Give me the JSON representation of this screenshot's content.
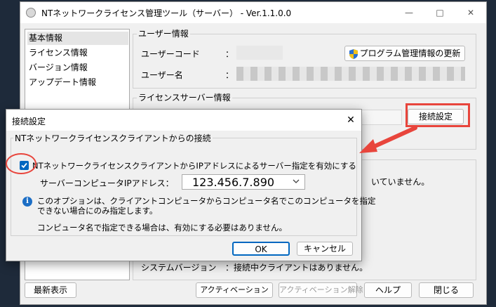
{
  "main": {
    "title": "NTネットワークライセンス管理ツール（サーバー） - Ver.1.1.0.0",
    "sidebar_items": [
      "基本情報",
      "ライセンス情報",
      "バージョン情報",
      "アップデート情報"
    ],
    "user_group_title": "ユーザー情報",
    "user_code_label": "ユーザーコード",
    "user_name_label": "ユーザー名",
    "colon": "：",
    "update_button_label": "プログラム管理情報の更新",
    "license_group_title": "ライセンスサーバー情報",
    "connect_settings_button_label": "接続設定",
    "right_status_text": "いていません。",
    "system_version_label": "システムバージョン",
    "system_version_value": "：接続中クライアントはありません。",
    "latest_button_label": "最新表示",
    "activation_button_label": "アクティベーション",
    "deactivation_button_label": "アクティベーション解除",
    "help_button_label": "ヘルプ",
    "close_button_label": "閉じる"
  },
  "dialog": {
    "title": "接続設定",
    "group_title": "NTネットワークライセンスクライアントからの接続",
    "checkbox_label": "NTネットワークライセンスクライアントからIPアドレスによるサーバー指定を有効にする",
    "checkbox_checked": true,
    "ip_label": "サーバーコンピュータIPアドレス：",
    "ip_value": "123.456.7.890",
    "info_line1": "このオプションは、クライアントコンピュータからコンピュータ名でこのコンピュータを指定",
    "info_line2": "できない場合にのみ指定します。",
    "info_line3": "コンピュータ名で指定できる場合は、有効にする必要はありません。",
    "ok_label": "OK",
    "cancel_label": "キャンセル"
  },
  "colors": {
    "accent": "#0067c0",
    "annotation_red": "#e8453c",
    "info_blue": "#1c6ec5"
  }
}
